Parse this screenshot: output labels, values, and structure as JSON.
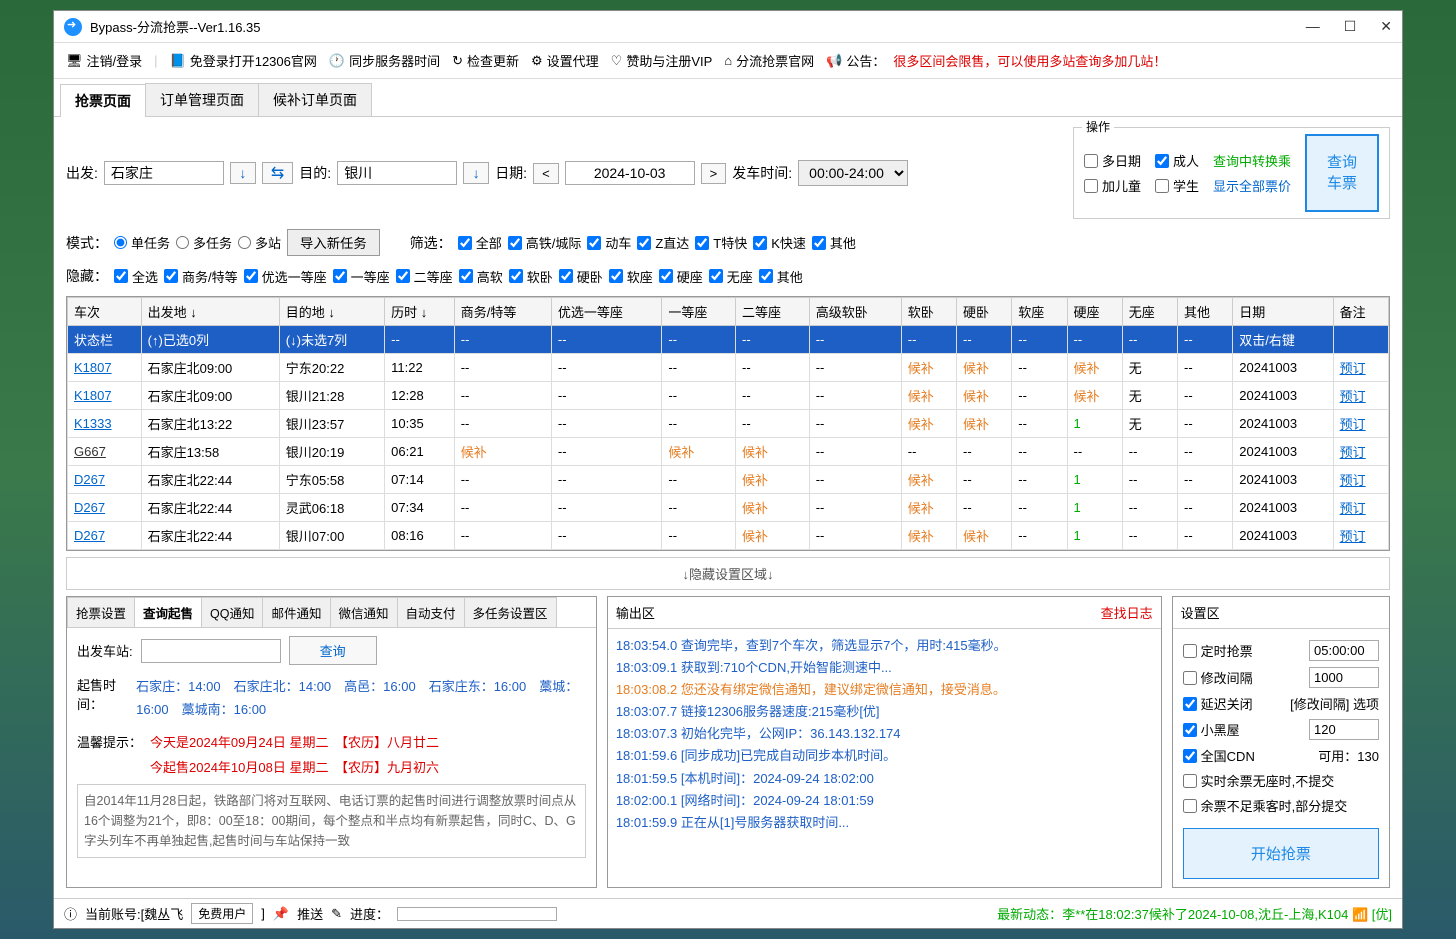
{
  "window": {
    "title": "Bypass-分流抢票--Ver1.16.35"
  },
  "toolbar": {
    "logout": "注销/登录",
    "open12306": "免登录打开12306官网",
    "sync": "同步服务器时间",
    "update": "检查更新",
    "proxy": "设置代理",
    "vip": "赞助与注册VIP",
    "official": "分流抢票官网",
    "announce_label": "公告：",
    "announce_text": "很多区间会限售，可以使用多站查询多加几站！"
  },
  "maintabs": {
    "t0": "抢票页面",
    "t1": "订单管理页面",
    "t2": "候补订单页面"
  },
  "search": {
    "depart_lbl": "出发:",
    "depart_val": "石家庄",
    "dest_lbl": "目的:",
    "dest_val": "银川",
    "date_lbl": "日期:",
    "date_val": "2024-10-03",
    "time_lbl": "发车时间:",
    "time_val": "00:00-24:00",
    "ops_title": "操作",
    "multidate": "多日期",
    "adult": "成人",
    "child": "加儿童",
    "student": "学生",
    "link1": "查询中转换乘",
    "link2": "显示全部票价",
    "bigbtn_l1": "查询",
    "bigbtn_l2": "车票",
    "mode_lbl": "模式：",
    "m1": "单任务",
    "m2": "多任务",
    "m3": "多站",
    "import": "导入新任务",
    "filter_lbl": "筛选：",
    "f_all": "全部",
    "f_gc": "高铁/城际",
    "f_d": "动车",
    "f_z": "Z直达",
    "f_t": "T特快",
    "f_k": "K快速",
    "f_other": "其他",
    "hide_lbl": "隐藏：",
    "h_all": "全选",
    "h_sw": "商务/特等",
    "h_yx": "优选一等座",
    "h_yd": "一等座",
    "h_ed": "二等座",
    "h_gr": "高软",
    "h_rw": "软卧",
    "h_yw": "硬卧",
    "h_rz": "软座",
    "h_yz": "硬座",
    "h_wz": "无座",
    "h_other": "其他"
  },
  "thead": [
    "车次",
    "出发地 ↓",
    "目的地 ↓",
    "历时 ↓",
    "商务/特等",
    "优选一等座",
    "一等座",
    "二等座",
    "高级软卧",
    "软卧",
    "硬卧",
    "软座",
    "硬座",
    "无座",
    "其他",
    "日期",
    "备注"
  ],
  "statusrow": {
    "c0": "状态栏",
    "c1": "(↑)已选0列",
    "c2": "(↓)未选7列",
    "c15": "双击/右键",
    "c16": ""
  },
  "rows": [
    {
      "tn": "K1807",
      "cls": "",
      "dep": "石家庄北09:00",
      "arr": "宁东20:22",
      "dur": "11:22",
      "sw": "--",
      "yx": "--",
      "yd": "--",
      "ed": "--",
      "gr": "--",
      "rw": "候补",
      "yw": "候补",
      "rz": "--",
      "yz": "候补",
      "wz": "无",
      "ot": "--",
      "dt": "20241003",
      "bk": "预订"
    },
    {
      "tn": "K1807",
      "cls": "",
      "dep": "石家庄北09:00",
      "arr": "银川21:28",
      "dur": "12:28",
      "sw": "--",
      "yx": "--",
      "yd": "--",
      "ed": "--",
      "gr": "--",
      "rw": "候补",
      "yw": "候补",
      "rz": "--",
      "yz": "候补",
      "wz": "无",
      "ot": "--",
      "dt": "20241003",
      "bk": "预订"
    },
    {
      "tn": "K1333",
      "cls": "",
      "dep": "石家庄北13:22",
      "arr": "银川23:57",
      "dur": "10:35",
      "sw": "--",
      "yx": "--",
      "yd": "--",
      "ed": "--",
      "gr": "--",
      "rw": "候补",
      "yw": "候补",
      "rz": "--",
      "yz": "1",
      "wz": "无",
      "ot": "--",
      "dt": "20241003",
      "bk": "预订"
    },
    {
      "tn": "G667",
      "cls": "u",
      "dep": "石家庄13:58",
      "arr": "银川20:19",
      "dur": "06:21",
      "sw": "候补",
      "yx": "--",
      "yd": "候补",
      "ed": "候补",
      "gr": "--",
      "rw": "--",
      "yw": "--",
      "rz": "--",
      "yz": "--",
      "wz": "--",
      "ot": "--",
      "dt": "20241003",
      "bk": "预订"
    },
    {
      "tn": "D267",
      "cls": "",
      "dep": "石家庄北22:44",
      "arr": "宁东05:58",
      "dur": "07:14",
      "sw": "--",
      "yx": "--",
      "yd": "--",
      "ed": "候补",
      "gr": "--",
      "rw": "候补",
      "yw": "--",
      "rz": "--",
      "yz": "1",
      "wz": "--",
      "ot": "--",
      "dt": "20241003",
      "bk": "预订"
    },
    {
      "tn": "D267",
      "cls": "",
      "dep": "石家庄北22:44",
      "arr": "灵武06:18",
      "dur": "07:34",
      "sw": "--",
      "yx": "--",
      "yd": "--",
      "ed": "候补",
      "gr": "--",
      "rw": "候补",
      "yw": "--",
      "rz": "--",
      "yz": "1",
      "wz": "--",
      "ot": "--",
      "dt": "20241003",
      "bk": "预订"
    },
    {
      "tn": "D267",
      "cls": "",
      "dep": "石家庄北22:44",
      "arr": "银川07:00",
      "dur": "08:16",
      "sw": "--",
      "yx": "--",
      "yd": "--",
      "ed": "候补",
      "gr": "--",
      "rw": "候补",
      "yw": "候补",
      "rz": "--",
      "yz": "1",
      "wz": "--",
      "ot": "--",
      "dt": "20241003",
      "bk": "预订"
    }
  ],
  "hidearea": "↓隐藏设置区域↓",
  "subtabs": {
    "t0": "抢票设置",
    "t1": "查询起售",
    "t2": "QQ通知",
    "t3": "邮件通知",
    "t4": "微信通知",
    "t5": "自动支付",
    "t6": "多任务设置区"
  },
  "sale": {
    "station_lbl": "出发车站:",
    "query": "查询",
    "time_lbl": "起售时间：",
    "times": "石家庄：14:00　石家庄北：14:00　高邑：16:00　石家庄东：16:00　藁城：16:00　藁城南：16:00",
    "tip_lbl": "温馨提示：",
    "tip1": "今天是2024年09月24日 星期二　【农历】八月廿二",
    "tip2": "今起售2024年10月08日 星期二　【农历】九月初六",
    "note": "自2014年11月28日起，铁路部门将对互联网、电话订票的起售时间进行调整放票时间点从16个调整为21个，即8：00至18：00期间，每个整点和半点均有新票起售，同时C、D、G字头列车不再单独起售,起售时间与车站保持一致"
  },
  "output": {
    "title": "输出区",
    "viewlog": "查找日志",
    "lines": [
      {
        "t": "18:03:54.0",
        "m": "查询完毕，查到7个车次，筛选显示7个，用时:415毫秒。",
        "c": ""
      },
      {
        "t": "18:03:09.1",
        "m": "获取到:710个CDN,开始智能测速中...",
        "c": ""
      },
      {
        "t": "18:03:08.2",
        "m": "您还没有绑定微信通知，建议绑定微信通知，接受消息。",
        "c": "log-orange"
      },
      {
        "t": "18:03:07.7",
        "m": "链接12306服务器速度:215毫秒[优]",
        "c": ""
      },
      {
        "t": "18:03:07.3",
        "m": "初始化完毕，公网IP：36.143.132.174",
        "c": ""
      },
      {
        "t": "18:01:59.6",
        "m": "[同步成功]已完成自动同步本机时间。",
        "c": ""
      },
      {
        "t": "18:01:59.5",
        "m": "[本机时间]：2024-09-24 18:02:00",
        "c": ""
      },
      {
        "t": "18:02:00.1",
        "m": "[网络时间]：2024-09-24 18:01:59",
        "c": ""
      },
      {
        "t": "18:01:59.9",
        "m": "正在从[1]号服务器获取时间...",
        "c": ""
      }
    ]
  },
  "settings": {
    "title": "设置区",
    "r1": "定时抢票",
    "v1": "05:00:00",
    "r2": "修改间隔",
    "v2": "1000",
    "r3": "延迟关闭",
    "r3b": "[修改间隔] 选项",
    "r4": "小黑屋",
    "v4": "120",
    "r5": "全国CDN",
    "r5b": "可用：130",
    "r6": "实时余票无座时,不提交",
    "r7": "余票不足乘客时,部分提交",
    "start": "开始抢票"
  },
  "status": {
    "account": "当前账号:[魏丛飞",
    "free": "免费用户",
    "push": "推送",
    "progress": "进度：",
    "news_lbl": "最新动态：",
    "news": "李**在18:02:37候补了2024-10-08,沈丘-上海,K104",
    "net": "[优]"
  }
}
